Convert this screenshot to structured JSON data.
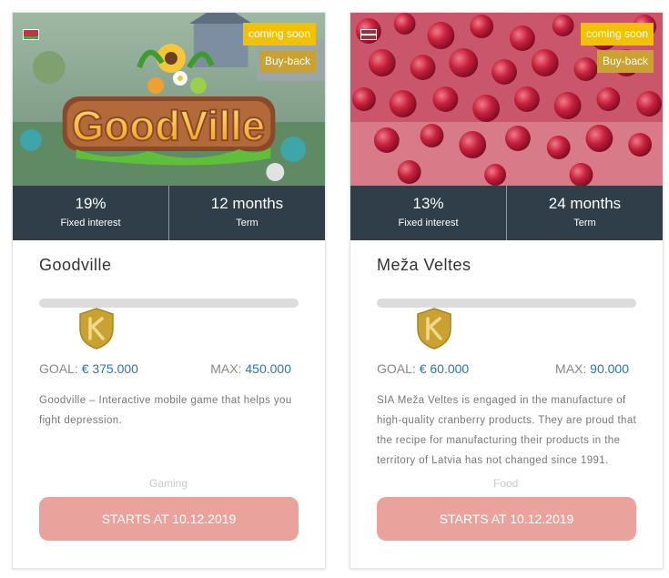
{
  "cards": [
    {
      "flag_colors": [
        "#c8313e",
        "#4aa657"
      ],
      "badge_soon": "coming soon",
      "badge_buyback": "Buy-back",
      "hero_logo_text": "GoodVille",
      "interest_value": "19%",
      "interest_label": "Fixed interest",
      "term_value": "12 months",
      "term_label": "Term",
      "title": "Goodville",
      "goal_label": "GOAL:",
      "goal_amount": "€ 375.000",
      "max_label": "MAX:",
      "max_amount": "450.000",
      "description": "Goodville – Interactive mobile game that helps you fight depression.",
      "category": "Gaming",
      "cta_label": "STARTS AT 10.12.2019",
      "progress": 0
    },
    {
      "flag_colors": [
        "#9e3039",
        "#ffffff",
        "#9e3039"
      ],
      "badge_soon": "coming soon",
      "badge_buyback": "Buy-back",
      "interest_value": "13%",
      "interest_label": "Fixed interest",
      "term_value": "24 months",
      "term_label": "Term",
      "title": "Meža Veltes",
      "goal_label": "GOAL:",
      "goal_amount": "€ 60.000",
      "max_label": "MAX:",
      "max_amount": "90.000",
      "description": "SIA Meža Veltes is engaged in the manufacture of high-quality cranberry products. They are proud that the recipe for manufacturing their products in the territory of Latvia has not changed since 1991.",
      "category": "Food",
      "cta_label": "STARTS AT 10.12.2019",
      "progress": 0
    }
  ],
  "colors": {
    "badge_soon": "#f2c200",
    "badge_buyback": "#c9a232",
    "stats_bg": "#2f3e48",
    "amount_blue": "#2a78a8",
    "cta": "#e9a29c",
    "shield_gold": "#c9a232"
  }
}
